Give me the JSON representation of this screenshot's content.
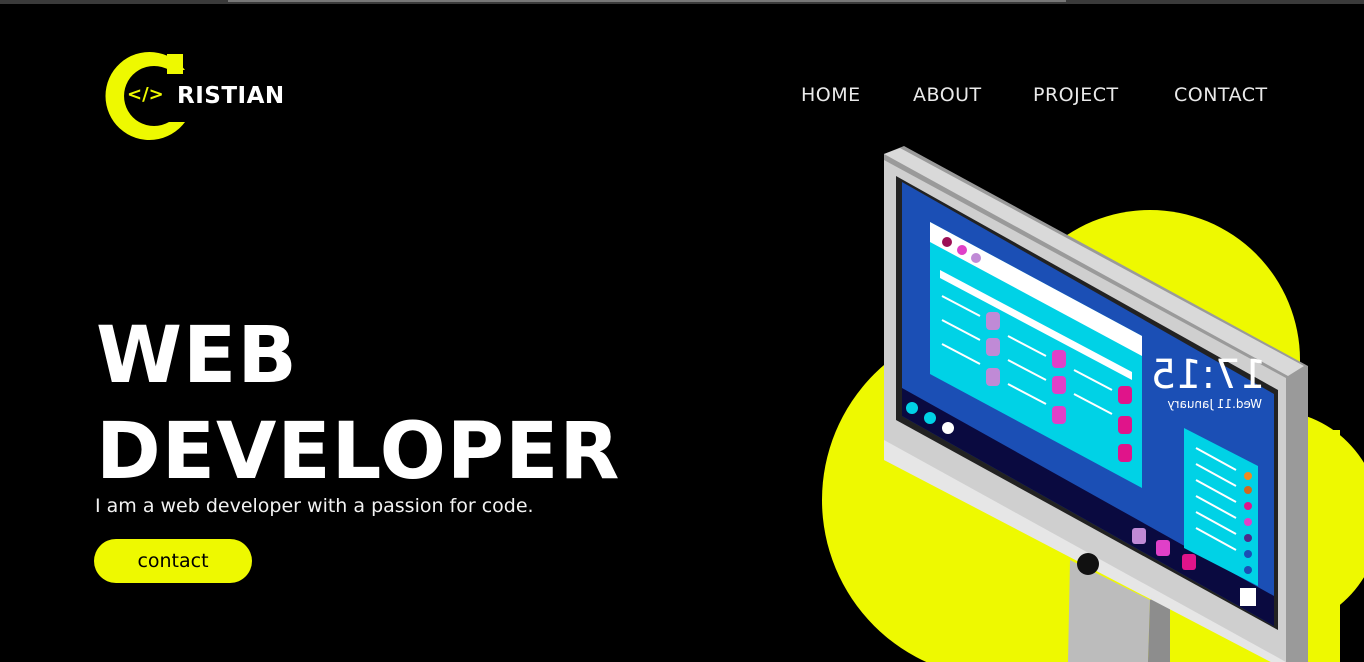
{
  "brand": {
    "logo_code": "</>",
    "logo_text": "RISTIAN",
    "accent_color": "#eef900"
  },
  "nav": {
    "items": [
      {
        "label": "HOME"
      },
      {
        "label": "ABOUT"
      },
      {
        "label": "PROJECT"
      },
      {
        "label": "CONTACT"
      }
    ]
  },
  "hero": {
    "title_line1": "WEB",
    "title_line2": "DEVELOPER",
    "subtitle": "I am a web developer with a passion for code.",
    "cta_label": "contact"
  },
  "illustration": {
    "clock_time": "17:15",
    "clock_date": "Wed.11 January",
    "icon": "desktop-monitor-icon"
  }
}
